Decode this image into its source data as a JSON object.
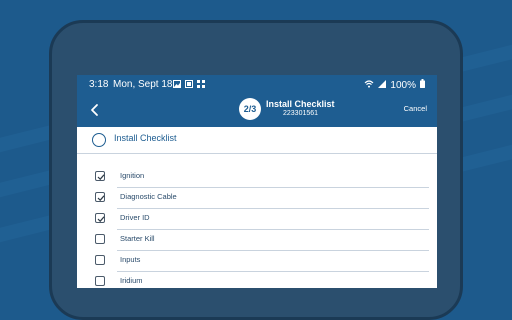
{
  "status_bar": {
    "time": "3:18",
    "date": "Mon, Sept 18",
    "battery": "100%",
    "icons": [
      "image-icon",
      "card-icon",
      "grid-icon",
      "wifi-icon",
      "signal-icon",
      "battery-icon"
    ]
  },
  "header": {
    "step": "2/3",
    "title": "Install Checklist",
    "subtitle": "223301561",
    "cancel_label": "Cancel",
    "back_icon": "chevron-left-icon"
  },
  "checklist": {
    "heading": "Install Checklist",
    "items": [
      {
        "label": "Ignition",
        "checked": true
      },
      {
        "label": "Diagnostic Cable",
        "checked": true
      },
      {
        "label": "Driver ID",
        "checked": true
      },
      {
        "label": "Starter Kill",
        "checked": false
      },
      {
        "label": "Inputs",
        "checked": false
      },
      {
        "label": "Iridium",
        "checked": false
      }
    ]
  },
  "colors": {
    "background": "#1d5a8c",
    "header": "#1e5d91",
    "accent": "#1e5d91",
    "divider": "#c9d3de"
  }
}
